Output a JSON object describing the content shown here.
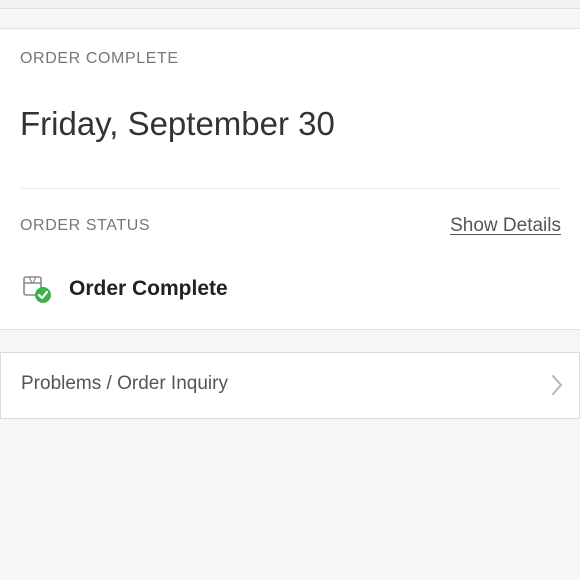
{
  "order": {
    "header_label": "ORDER COMPLETE",
    "date": "Friday, September 30",
    "status_label": "ORDER STATUS",
    "show_details_label": "Show Details",
    "status_text": "Order Complete",
    "status_icon": "package-check-icon",
    "status_color": "#3cb34a"
  },
  "inquiry": {
    "label": "Problems / Order Inquiry",
    "icon": "chevron-right-icon"
  }
}
